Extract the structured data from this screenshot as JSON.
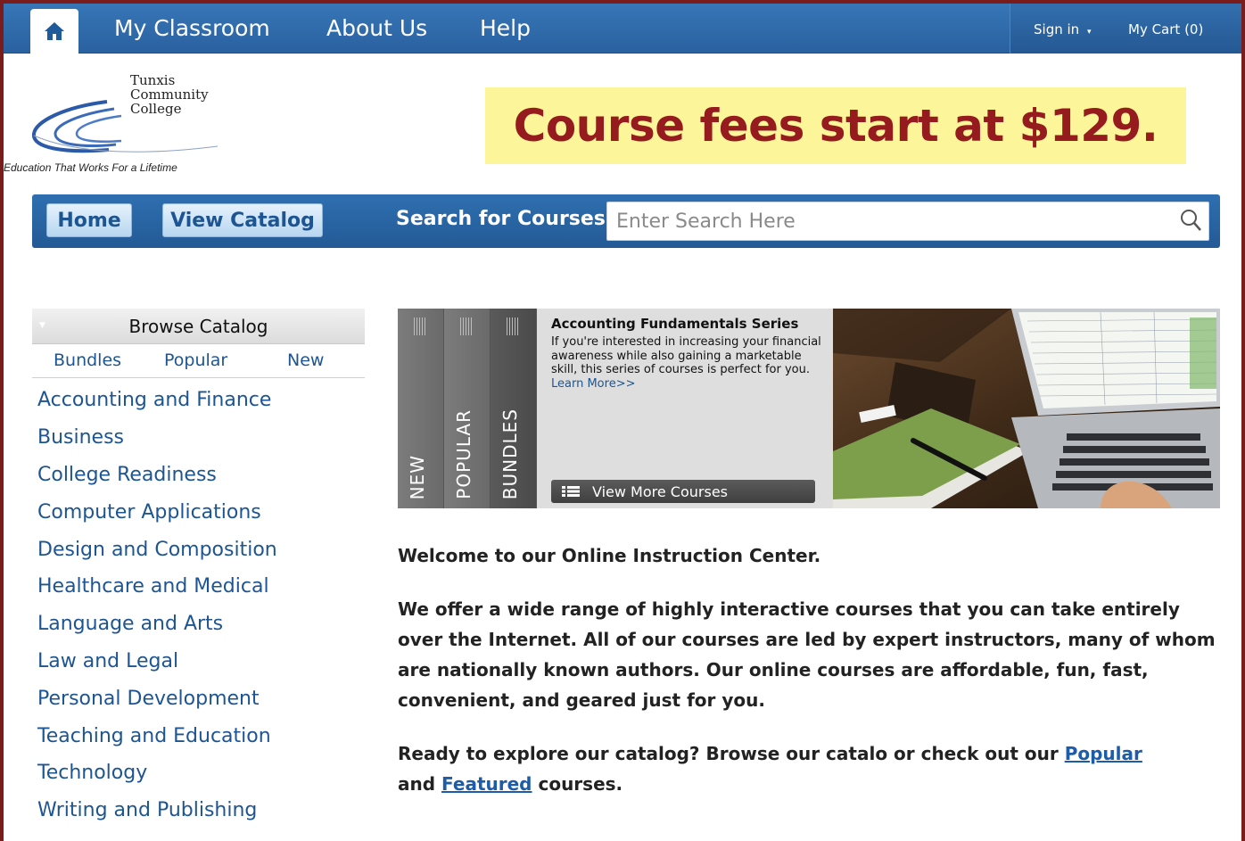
{
  "top_nav": {
    "items": [
      "My Classroom",
      "About Us",
      "Help"
    ],
    "sign_in": "Sign in",
    "cart": "My Cart (0)"
  },
  "logo": {
    "name_lines": [
      "Tunxis",
      "Community",
      "College"
    ],
    "tagline": "Education That Works For a Lifetime"
  },
  "promo": {
    "text": "Course fees start at $129."
  },
  "search_bar": {
    "home_label": "Home",
    "catalog_label": "View Catalog",
    "search_label": "Search for Courses:",
    "placeholder": "Enter Search Here"
  },
  "sidebar": {
    "browse_title": "Browse Catalog",
    "tabs": [
      "Bundles",
      "Popular",
      "New"
    ],
    "categories": [
      "Accounting and Finance",
      "Business",
      "College Readiness",
      "Computer Applications",
      "Design and Composition",
      "Healthcare and Medical",
      "Language and Arts",
      "Law and Legal",
      "Personal Development",
      "Teaching and Education",
      "Technology",
      "Writing and Publishing"
    ]
  },
  "featured": {
    "tabs": [
      "NEW",
      "POPULAR",
      "BUNDLES"
    ],
    "title": "Accounting Fundamentals Series",
    "description": "If you're interested in increasing your financial awareness while also gaining a marketable skill, this series of courses is perfect for you.",
    "learn_more": "Learn More>>",
    "view_more": "View More Courses"
  },
  "welcome": {
    "heading": "Welcome to our Online Instruction Center.",
    "body": "We offer a wide range of highly interactive courses that you can take entirely over the Internet. All of our courses are led by expert instructors, many of whom are nationally known authors. Our online courses are affordable, fun, fast, convenient, and geared just for you.",
    "explore_prefix": "Ready to explore our catalog? Browse our catalo or check out our",
    "popular_link": "Popular",
    "and_text": "and",
    "featured_link": "Featured",
    "courses_suffix": "courses."
  }
}
